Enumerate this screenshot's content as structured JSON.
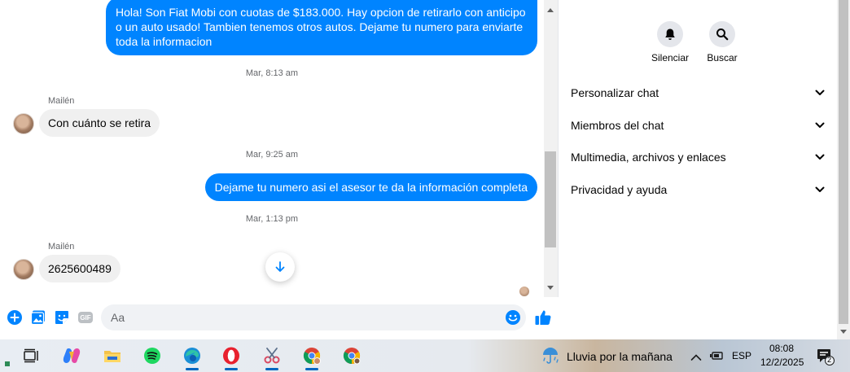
{
  "chat": {
    "messages": [
      {
        "type": "outgoing",
        "text": "Hola! Son Fiat Mobi con cuotas de $183.000. Hay opcion de retirarlo con anticipo o un auto usado! Tambien tenemos otros autos. Dejame tu numero para enviarte toda la informacion"
      },
      {
        "type": "timestamp",
        "text": "Mar, 8:13 am"
      },
      {
        "type": "sender",
        "text": "Mailén"
      },
      {
        "type": "incoming",
        "text": "Con cuánto se retira"
      },
      {
        "type": "timestamp",
        "text": "Mar, 9:25 am"
      },
      {
        "type": "outgoing",
        "text": "Dejame tu numero asi el asesor te da la información completa"
      },
      {
        "type": "timestamp",
        "text": "Mar, 1:13 pm"
      },
      {
        "type": "sender",
        "text": "Mailén"
      },
      {
        "type": "incoming",
        "text": "2625600489"
      }
    ]
  },
  "composer": {
    "placeholder": "Aa",
    "icons": [
      "plus-icon",
      "photo-icon",
      "sticker-icon",
      "gif-icon",
      "emoji-icon",
      "thumbs-up-icon"
    ],
    "gif_label": "GIF"
  },
  "right_panel": {
    "actions": [
      {
        "label": "Silenciar",
        "icon": "bell-icon"
      },
      {
        "label": "Buscar",
        "icon": "search-icon"
      }
    ],
    "sections": [
      {
        "label": "Personalizar chat"
      },
      {
        "label": "Miembros del chat"
      },
      {
        "label": "Multimedia, archivos y enlaces"
      },
      {
        "label": "Privacidad y ayuda"
      }
    ]
  },
  "taskbar": {
    "apps": [
      "task-view-icon",
      "copilot-icon",
      "file-explorer-icon",
      "spotify-icon",
      "edge-icon",
      "opera-icon",
      "snipping-tool-icon",
      "chrome-profile-icon",
      "chrome-icon"
    ],
    "weather": "Lluvia por la mañana",
    "language": "ESP",
    "time": "08:08",
    "date": "12/2/2025",
    "notification_count": "2"
  },
  "colors": {
    "accent": "#0084ff",
    "incoming_bubble": "#f0f0f0",
    "panel_bg": "#ffffff"
  }
}
